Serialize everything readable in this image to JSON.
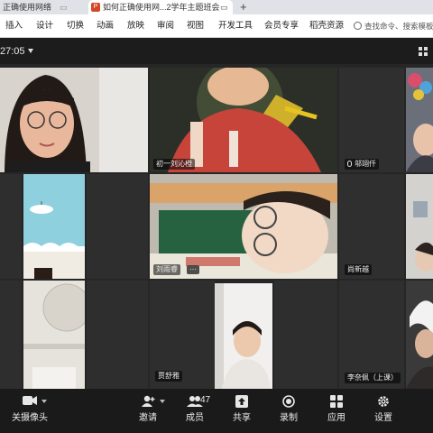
{
  "browser": {
    "tabs": [
      {
        "label": "正确使用网络"
      },
      {
        "label": "如何正确使用网...2学年主题班会"
      }
    ],
    "new_tab": "+",
    "ppt_badge": "P"
  },
  "ribbon": {
    "items": [
      "插入",
      "设计",
      "切换",
      "动画",
      "放映",
      "审阅",
      "视图",
      "开发工具",
      "会员专享",
      "稻壳资源"
    ],
    "search_placeholder": "查找命令、搜索模板"
  },
  "meeting": {
    "timer": "27:05"
  },
  "participants": [
    {
      "name": ""
    },
    {
      "name": "初一刘沁橙"
    },
    {
      "name": "邬翊仟"
    },
    {
      "name": ""
    },
    {
      "name": "刘雨睿"
    },
    {
      "name": "尚新越"
    },
    {
      "name": ""
    },
    {
      "name": "贾舒雅"
    },
    {
      "name": "李奈佩（上课）"
    }
  ],
  "more_label": "···",
  "toolbar": {
    "camera": "关摄像头",
    "invite": "邀请",
    "members": "成员",
    "members_count": "47",
    "share": "共享",
    "record": "录制",
    "apps": "应用",
    "settings": "设置"
  },
  "colors": {
    "accent": "#d24726",
    "toolbar_bg": "#1a1a1a",
    "grid_bg": "#262626"
  }
}
